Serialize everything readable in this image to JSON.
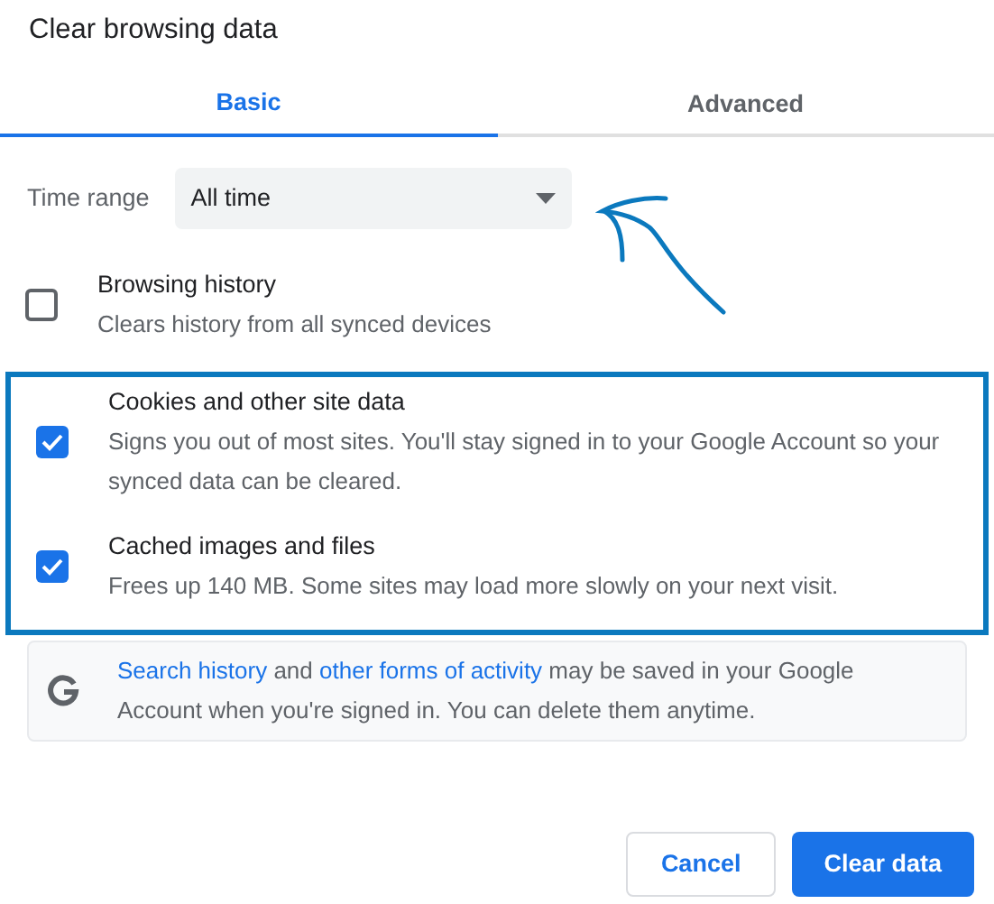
{
  "dialog": {
    "title": "Clear browsing data"
  },
  "tabs": [
    {
      "label": "Basic",
      "selected": true
    },
    {
      "label": "Advanced",
      "selected": false
    }
  ],
  "time_range": {
    "label": "Time range",
    "value": "All time"
  },
  "options": [
    {
      "label": "Browsing history",
      "description": "Clears history from all synced devices",
      "checked": false,
      "highlighted": false
    },
    {
      "label": "Cookies and other site data",
      "description": "Signs you out of most sites. You'll stay signed in to your Google Account so your synced data can be cleared.",
      "checked": true,
      "highlighted": true
    },
    {
      "label": "Cached images and files",
      "description": "Frees up 140 MB. Some sites may load more slowly on your next visit.",
      "checked": true,
      "highlighted": true
    }
  ],
  "notice": {
    "segments": [
      {
        "kind": "link",
        "text": "Search history"
      },
      {
        "kind": "text",
        "text": " and "
      },
      {
        "kind": "link",
        "text": "other forms of activity"
      },
      {
        "kind": "text",
        "text": " may be saved in your Google Account when you're signed in. You can delete them anytime."
      }
    ]
  },
  "buttons": [
    {
      "label": "Cancel",
      "kind": "secondary"
    },
    {
      "label": "Clear data",
      "kind": "primary"
    }
  ]
}
